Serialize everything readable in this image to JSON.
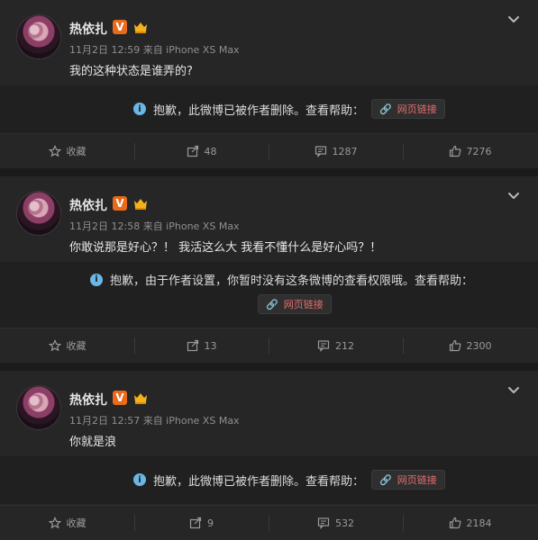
{
  "posts": [
    {
      "user": "热依扎",
      "verified_label": "V",
      "meta": "11月2日 12:59 来自 iPhone XS Max",
      "text": "我的这种状态是谁弄的?",
      "notice": "抱歉，此微博已被作者删除。查看帮助：",
      "link": "网页链接",
      "actions": {
        "favorite": "收藏",
        "repost": "48",
        "comment": "1287",
        "like": "7276"
      }
    },
    {
      "user": "热依扎",
      "verified_label": "V",
      "meta": "11月2日 12:58 来自 iPhone XS Max",
      "text": "你敢说那是好心？！ 我活这么大 我看不懂什么是好心吗？！",
      "notice": "抱歉，由于作者设置，你暂时没有这条微博的查看权限哦。查看帮助：",
      "link": "网页链接",
      "actions": {
        "favorite": "收藏",
        "repost": "13",
        "comment": "212",
        "like": "2300"
      }
    },
    {
      "user": "热依扎",
      "verified_label": "V",
      "meta": "11月2日 12:57 来自 iPhone XS Max",
      "text": "你就是浪",
      "notice": "抱歉，此微博已被作者删除。查看帮助：",
      "link": "网页链接",
      "actions": {
        "favorite": "收藏",
        "repost": "9",
        "comment": "532",
        "like": "2184"
      }
    }
  ],
  "icons": {
    "chevron": "chevron-down-icon",
    "info": "info-icon",
    "link": "link-icon",
    "favorite": "star-icon",
    "repost": "repost-icon",
    "comment": "comment-icon",
    "like": "thumbs-up-icon"
  }
}
